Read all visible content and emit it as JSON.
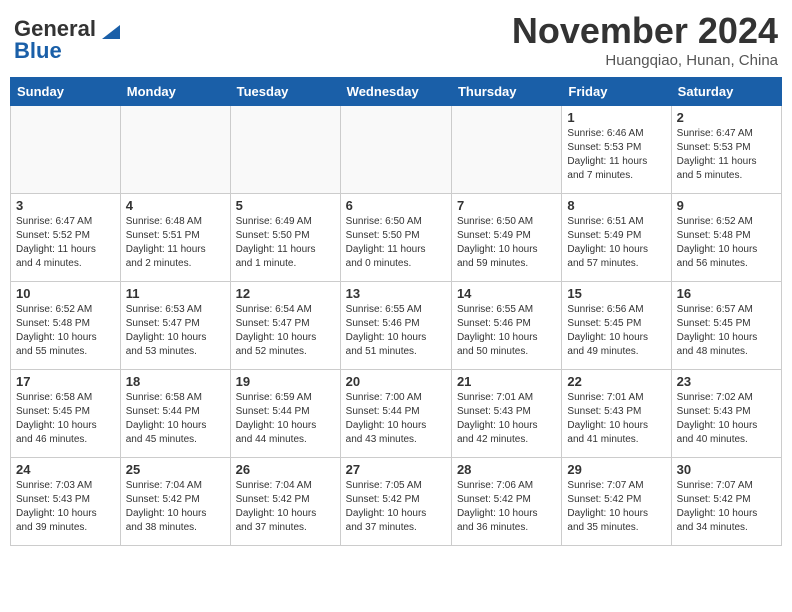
{
  "header": {
    "logo_line1": "General",
    "logo_line2": "Blue",
    "month": "November 2024",
    "location": "Huangqiao, Hunan, China"
  },
  "weekdays": [
    "Sunday",
    "Monday",
    "Tuesday",
    "Wednesday",
    "Thursday",
    "Friday",
    "Saturday"
  ],
  "weeks": [
    [
      {
        "day": "",
        "info": ""
      },
      {
        "day": "",
        "info": ""
      },
      {
        "day": "",
        "info": ""
      },
      {
        "day": "",
        "info": ""
      },
      {
        "day": "",
        "info": ""
      },
      {
        "day": "1",
        "info": "Sunrise: 6:46 AM\nSunset: 5:53 PM\nDaylight: 11 hours\nand 7 minutes."
      },
      {
        "day": "2",
        "info": "Sunrise: 6:47 AM\nSunset: 5:53 PM\nDaylight: 11 hours\nand 5 minutes."
      }
    ],
    [
      {
        "day": "3",
        "info": "Sunrise: 6:47 AM\nSunset: 5:52 PM\nDaylight: 11 hours\nand 4 minutes."
      },
      {
        "day": "4",
        "info": "Sunrise: 6:48 AM\nSunset: 5:51 PM\nDaylight: 11 hours\nand 2 minutes."
      },
      {
        "day": "5",
        "info": "Sunrise: 6:49 AM\nSunset: 5:50 PM\nDaylight: 11 hours\nand 1 minute."
      },
      {
        "day": "6",
        "info": "Sunrise: 6:50 AM\nSunset: 5:50 PM\nDaylight: 11 hours\nand 0 minutes."
      },
      {
        "day": "7",
        "info": "Sunrise: 6:50 AM\nSunset: 5:49 PM\nDaylight: 10 hours\nand 59 minutes."
      },
      {
        "day": "8",
        "info": "Sunrise: 6:51 AM\nSunset: 5:49 PM\nDaylight: 10 hours\nand 57 minutes."
      },
      {
        "day": "9",
        "info": "Sunrise: 6:52 AM\nSunset: 5:48 PM\nDaylight: 10 hours\nand 56 minutes."
      }
    ],
    [
      {
        "day": "10",
        "info": "Sunrise: 6:52 AM\nSunset: 5:48 PM\nDaylight: 10 hours\nand 55 minutes."
      },
      {
        "day": "11",
        "info": "Sunrise: 6:53 AM\nSunset: 5:47 PM\nDaylight: 10 hours\nand 53 minutes."
      },
      {
        "day": "12",
        "info": "Sunrise: 6:54 AM\nSunset: 5:47 PM\nDaylight: 10 hours\nand 52 minutes."
      },
      {
        "day": "13",
        "info": "Sunrise: 6:55 AM\nSunset: 5:46 PM\nDaylight: 10 hours\nand 51 minutes."
      },
      {
        "day": "14",
        "info": "Sunrise: 6:55 AM\nSunset: 5:46 PM\nDaylight: 10 hours\nand 50 minutes."
      },
      {
        "day": "15",
        "info": "Sunrise: 6:56 AM\nSunset: 5:45 PM\nDaylight: 10 hours\nand 49 minutes."
      },
      {
        "day": "16",
        "info": "Sunrise: 6:57 AM\nSunset: 5:45 PM\nDaylight: 10 hours\nand 48 minutes."
      }
    ],
    [
      {
        "day": "17",
        "info": "Sunrise: 6:58 AM\nSunset: 5:45 PM\nDaylight: 10 hours\nand 46 minutes."
      },
      {
        "day": "18",
        "info": "Sunrise: 6:58 AM\nSunset: 5:44 PM\nDaylight: 10 hours\nand 45 minutes."
      },
      {
        "day": "19",
        "info": "Sunrise: 6:59 AM\nSunset: 5:44 PM\nDaylight: 10 hours\nand 44 minutes."
      },
      {
        "day": "20",
        "info": "Sunrise: 7:00 AM\nSunset: 5:44 PM\nDaylight: 10 hours\nand 43 minutes."
      },
      {
        "day": "21",
        "info": "Sunrise: 7:01 AM\nSunset: 5:43 PM\nDaylight: 10 hours\nand 42 minutes."
      },
      {
        "day": "22",
        "info": "Sunrise: 7:01 AM\nSunset: 5:43 PM\nDaylight: 10 hours\nand 41 minutes."
      },
      {
        "day": "23",
        "info": "Sunrise: 7:02 AM\nSunset: 5:43 PM\nDaylight: 10 hours\nand 40 minutes."
      }
    ],
    [
      {
        "day": "24",
        "info": "Sunrise: 7:03 AM\nSunset: 5:43 PM\nDaylight: 10 hours\nand 39 minutes."
      },
      {
        "day": "25",
        "info": "Sunrise: 7:04 AM\nSunset: 5:42 PM\nDaylight: 10 hours\nand 38 minutes."
      },
      {
        "day": "26",
        "info": "Sunrise: 7:04 AM\nSunset: 5:42 PM\nDaylight: 10 hours\nand 37 minutes."
      },
      {
        "day": "27",
        "info": "Sunrise: 7:05 AM\nSunset: 5:42 PM\nDaylight: 10 hours\nand 37 minutes."
      },
      {
        "day": "28",
        "info": "Sunrise: 7:06 AM\nSunset: 5:42 PM\nDaylight: 10 hours\nand 36 minutes."
      },
      {
        "day": "29",
        "info": "Sunrise: 7:07 AM\nSunset: 5:42 PM\nDaylight: 10 hours\nand 35 minutes."
      },
      {
        "day": "30",
        "info": "Sunrise: 7:07 AM\nSunset: 5:42 PM\nDaylight: 10 hours\nand 34 minutes."
      }
    ]
  ]
}
